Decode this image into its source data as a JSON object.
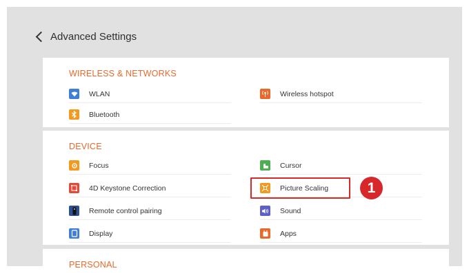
{
  "header": {
    "title": "Advanced Settings"
  },
  "sections": {
    "wireless": {
      "title": "WIRELESS & NETWORKS",
      "items": [
        {
          "label": "WLAN",
          "icon": "wifi-icon",
          "color": "#3f7fd6"
        },
        {
          "label": "Wireless hotspot",
          "icon": "hotspot-icon",
          "color": "#e8692b"
        },
        {
          "label": "Bluetooth",
          "icon": "bluetooth-icon",
          "color": "#f39a1e"
        }
      ]
    },
    "device": {
      "title": "DEVICE",
      "items": [
        {
          "label": "Focus",
          "icon": "focus-icon",
          "color": "#f39a1e"
        },
        {
          "label": "Cursor",
          "icon": "cursor-icon",
          "color": "#4caf50"
        },
        {
          "label": "4D Keystone Correction",
          "icon": "keystone-icon",
          "color": "#e04b3a"
        },
        {
          "label": "Picture Scaling",
          "icon": "picture-scaling-icon",
          "color": "#f39a1e"
        },
        {
          "label": "Remote control pairing",
          "icon": "remote-icon",
          "color": "#2b4f8f"
        },
        {
          "label": "Sound",
          "icon": "sound-icon",
          "color": "#5b5fc7"
        },
        {
          "label": "Display",
          "icon": "display-icon",
          "color": "#3f7fd6"
        },
        {
          "label": "Apps",
          "icon": "apps-icon",
          "color": "#e8692b"
        }
      ]
    },
    "personal": {
      "title": "PERSONAL"
    }
  },
  "annotation": {
    "callout_number": "1",
    "highlight_color": "#d42a2a"
  },
  "colors": {
    "section_title": "#e8692b",
    "panel_bg": "#e1e1e1"
  }
}
